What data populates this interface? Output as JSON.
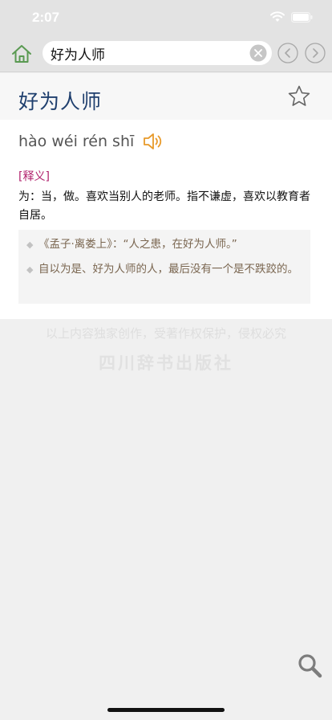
{
  "status_bar": {
    "time": "2:07"
  },
  "nav": {
    "search_value": "好为人师"
  },
  "entry": {
    "word": "好为人师",
    "pinyin": "hào wéi rén shī",
    "section_label": "[释义]",
    "definition": "为：当，做。喜欢当别人的老师。指不谦虚，喜欢以教育者自居。",
    "quotes": [
      "《孟子·离娄上》：“人之患，在好为人师。”",
      "自以为是、好为人师的人，最后没有一个是不跌跤的。"
    ]
  },
  "footer": {
    "copyright": "以上内容独家创作，受著作权保护，侵权必究",
    "publisher": "四川辞书出版社"
  },
  "icons": {
    "home": "home-icon",
    "clear": "clear-icon",
    "back": "chevron-left-icon",
    "forward": "chevron-right-icon",
    "star": "star-icon",
    "sound": "speaker-icon",
    "search": "search-icon"
  },
  "colors": {
    "title": "#1f3f6e",
    "label": "#b0206c",
    "quote": "#7a6650",
    "home_icon": "#5a9a52",
    "sound_icon": "#e89a2a"
  }
}
